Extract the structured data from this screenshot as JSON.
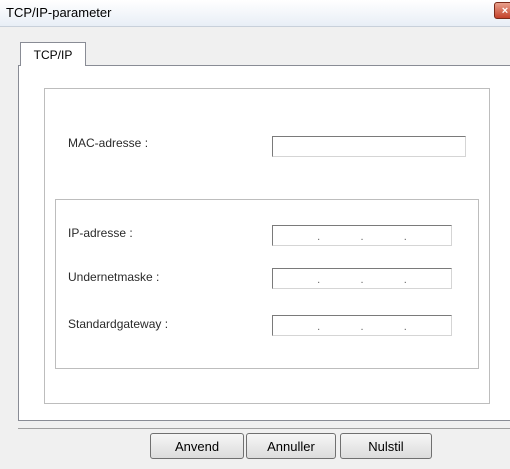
{
  "window": {
    "title": "TCP/IP-parameter",
    "close_glyph": "×"
  },
  "tabs": [
    {
      "label": "TCP/IP",
      "selected": true
    }
  ],
  "fields": {
    "mac": {
      "label": "MAC-adresse :",
      "value": ""
    },
    "ip": {
      "label": "IP-adresse :",
      "octets": [
        "",
        "",
        "",
        ""
      ],
      "separator": "."
    },
    "subnet": {
      "label": "Undernetmaske :",
      "octets": [
        "",
        "",
        "",
        ""
      ],
      "separator": "."
    },
    "gateway": {
      "label": "Standardgateway :",
      "octets": [
        "",
        "",
        "",
        ""
      ],
      "separator": "."
    }
  },
  "buttons": {
    "apply": "Anvend",
    "cancel": "Annuller",
    "reset": "Nulstil"
  }
}
